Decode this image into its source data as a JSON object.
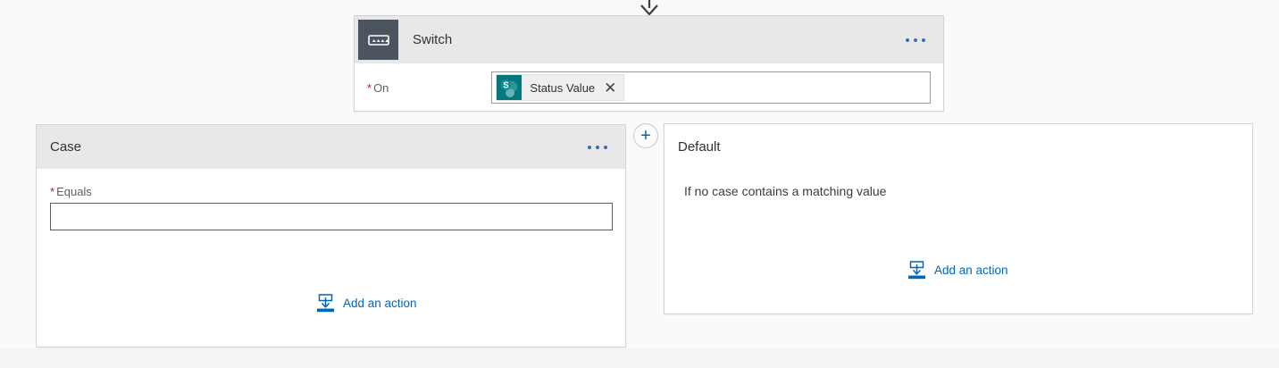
{
  "colors": {
    "accent_blue": "#0067b8",
    "header_gray": "#e8e8e8",
    "switch_icon_slate": "#4a5560",
    "sharepoint_teal": "#03787c",
    "required_red": "#a4262c"
  },
  "switch_card": {
    "title": "Switch",
    "field": {
      "required_marker": "*",
      "label": "On",
      "token": {
        "connector": "sharepoint",
        "label": "Status Value",
        "remove_glyph": "✕"
      }
    }
  },
  "case_card": {
    "title": "Case",
    "field": {
      "required_marker": "*",
      "label": "Equals",
      "value": "",
      "placeholder": ""
    },
    "add_action_label": "Add an action"
  },
  "add_case_button": {
    "symbol": "+"
  },
  "default_card": {
    "title": "Default",
    "description": "If no case contains a matching value",
    "add_action_label": "Add an action"
  }
}
